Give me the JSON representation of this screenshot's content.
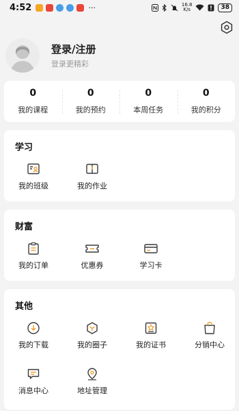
{
  "status_bar": {
    "time": "4:52",
    "net_speed_value": "16.8",
    "net_speed_unit": "K/s",
    "battery": "38",
    "more": "···"
  },
  "profile": {
    "title": "登录/注册",
    "subtitle": "登录更精彩"
  },
  "stats": [
    {
      "value": "0",
      "label": "我的课程"
    },
    {
      "value": "0",
      "label": "我的预约"
    },
    {
      "value": "0",
      "label": "本周任务"
    },
    {
      "value": "0",
      "label": "我的积分"
    }
  ],
  "sections": {
    "study": {
      "title": "学习",
      "items": [
        {
          "label": "我的班级",
          "icon": "class-icon"
        },
        {
          "label": "我的作业",
          "icon": "homework-icon"
        }
      ]
    },
    "wealth": {
      "title": "财富",
      "items": [
        {
          "label": "我的订单",
          "icon": "order-icon"
        },
        {
          "label": "优惠券",
          "icon": "coupon-icon"
        },
        {
          "label": "学习卡",
          "icon": "card-icon"
        }
      ]
    },
    "other": {
      "title": "其他",
      "items": [
        {
          "label": "我的下载",
          "icon": "download-icon"
        },
        {
          "label": "我的圈子",
          "icon": "circle-icon"
        },
        {
          "label": "我的证书",
          "icon": "certificate-icon"
        },
        {
          "label": "分销中心",
          "icon": "distribution-icon"
        },
        {
          "label": "消息中心",
          "icon": "message-icon"
        },
        {
          "label": "地址管理",
          "icon": "location-icon"
        }
      ]
    }
  },
  "colors": {
    "icon_dark": "#3a3a3a",
    "icon_accent": "#f0a23b",
    "background": "#f3f3f3"
  }
}
